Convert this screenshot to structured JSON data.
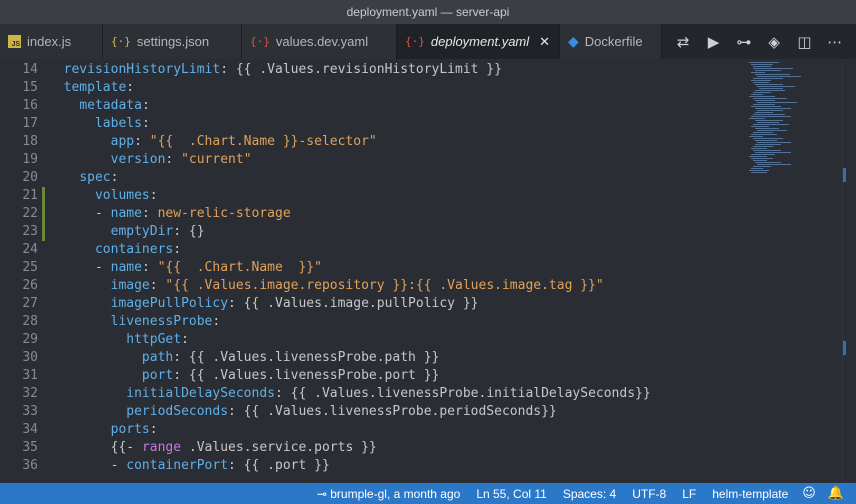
{
  "window": {
    "title": "deployment.yaml — server-api"
  },
  "tabs": [
    {
      "label": "index.js",
      "icon": "js-file-icon",
      "active": false
    },
    {
      "label": "settings.json",
      "icon": "json-file-icon",
      "active": false
    },
    {
      "label": "values.dev.yaml",
      "icon": "yaml-file-icon",
      "active": false
    },
    {
      "label": "deployment.yaml",
      "icon": "yaml-file-icon",
      "active": true
    },
    {
      "label": "Dockerfile",
      "icon": "docker-icon",
      "active": false
    }
  ],
  "editor": {
    "lines": [
      {
        "n": "14",
        "indent": 0,
        "tokens": [
          [
            "k",
            "revisionHistoryLimit"
          ],
          [
            "p",
            ": {{ .Values.revisionHistoryLimit }}"
          ]
        ]
      },
      {
        "n": "15",
        "indent": 0,
        "tokens": [
          [
            "k",
            "template"
          ],
          [
            "p",
            ":"
          ]
        ]
      },
      {
        "n": "16",
        "indent": 1,
        "tokens": [
          [
            "k",
            "metadata"
          ],
          [
            "p",
            ":"
          ]
        ]
      },
      {
        "n": "17",
        "indent": 2,
        "tokens": [
          [
            "k",
            "labels"
          ],
          [
            "p",
            ":"
          ]
        ]
      },
      {
        "n": "18",
        "indent": 3,
        "tokens": [
          [
            "k",
            "app"
          ],
          [
            "p",
            ": "
          ],
          [
            "s",
            "\"{{  .Chart.Name }}-selector\""
          ]
        ]
      },
      {
        "n": "19",
        "indent": 3,
        "tokens": [
          [
            "k",
            "version"
          ],
          [
            "p",
            ": "
          ],
          [
            "s",
            "\"current\""
          ]
        ]
      },
      {
        "n": "20",
        "indent": 1,
        "tokens": [
          [
            "k",
            "spec"
          ],
          [
            "p",
            ":"
          ]
        ]
      },
      {
        "n": "21",
        "indent": 2,
        "tokens": [
          [
            "k",
            "volumes"
          ],
          [
            "p",
            ":"
          ]
        ]
      },
      {
        "n": "22",
        "indent": 2,
        "tokens": [
          [
            "p",
            "- "
          ],
          [
            "k",
            "name"
          ],
          [
            "p",
            ": "
          ],
          [
            "s",
            "new-relic-storage"
          ]
        ]
      },
      {
        "n": "23",
        "indent": 3,
        "tokens": [
          [
            "k",
            "emptyDir"
          ],
          [
            "p",
            ": {}"
          ]
        ]
      },
      {
        "n": "24",
        "indent": 2,
        "tokens": [
          [
            "k",
            "containers"
          ],
          [
            "p",
            ":"
          ]
        ]
      },
      {
        "n": "25",
        "indent": 2,
        "tokens": [
          [
            "p",
            "- "
          ],
          [
            "k",
            "name"
          ],
          [
            "p",
            ": "
          ],
          [
            "s",
            "\"{{  .Chart.Name  }}\""
          ]
        ]
      },
      {
        "n": "26",
        "indent": 3,
        "tokens": [
          [
            "k",
            "image"
          ],
          [
            "p",
            ": "
          ],
          [
            "s",
            "\"{{ .Values.image.repository }}:{{ .Values.image.tag }}\""
          ]
        ]
      },
      {
        "n": "27",
        "indent": 3,
        "tokens": [
          [
            "k",
            "imagePullPolicy"
          ],
          [
            "p",
            ": {{ .Values.image.pullPolicy }}"
          ]
        ]
      },
      {
        "n": "28",
        "indent": 3,
        "tokens": [
          [
            "k",
            "livenessProbe"
          ],
          [
            "p",
            ":"
          ]
        ]
      },
      {
        "n": "29",
        "indent": 4,
        "tokens": [
          [
            "k",
            "httpGet"
          ],
          [
            "p",
            ":"
          ]
        ]
      },
      {
        "n": "30",
        "indent": 5,
        "tokens": [
          [
            "k",
            "path"
          ],
          [
            "p",
            ": {{ .Values.livenessProbe.path }}"
          ]
        ]
      },
      {
        "n": "31",
        "indent": 5,
        "tokens": [
          [
            "k",
            "port"
          ],
          [
            "p",
            ": {{ .Values.livenessProbe.port }}"
          ]
        ]
      },
      {
        "n": "32",
        "indent": 4,
        "tokens": [
          [
            "k",
            "initialDelaySeconds"
          ],
          [
            "p",
            ": {{ .Values.livenessProbe.initialDelaySeconds}}"
          ]
        ]
      },
      {
        "n": "33",
        "indent": 4,
        "tokens": [
          [
            "k",
            "periodSeconds"
          ],
          [
            "p",
            ": {{ .Values.livenessProbe.periodSeconds}}"
          ]
        ]
      },
      {
        "n": "34",
        "indent": 3,
        "tokens": [
          [
            "k",
            "ports"
          ],
          [
            "p",
            ":"
          ]
        ]
      },
      {
        "n": "35",
        "indent": 3,
        "tokens": [
          [
            "p",
            "{{- "
          ],
          [
            "kw",
            "range"
          ],
          [
            "p",
            " .Values.service.ports }}"
          ]
        ]
      },
      {
        "n": "36",
        "indent": 3,
        "tokens": [
          [
            "p",
            "- "
          ],
          [
            "k",
            "containerPort"
          ],
          [
            "p",
            ": {{ .port }}"
          ]
        ]
      }
    ]
  },
  "status": {
    "blame": "brumple-gl, a month ago",
    "position": "Ln 55, Col 11",
    "indent": "Spaces: 4",
    "encoding": "UTF-8",
    "eol": "LF",
    "language": "helm-template"
  },
  "colors": {
    "status_bar": "#2b78c9",
    "editor_bg": "#2a2d33",
    "yaml_key": "#5fb0e8",
    "yaml_string": "#e0a25b"
  }
}
